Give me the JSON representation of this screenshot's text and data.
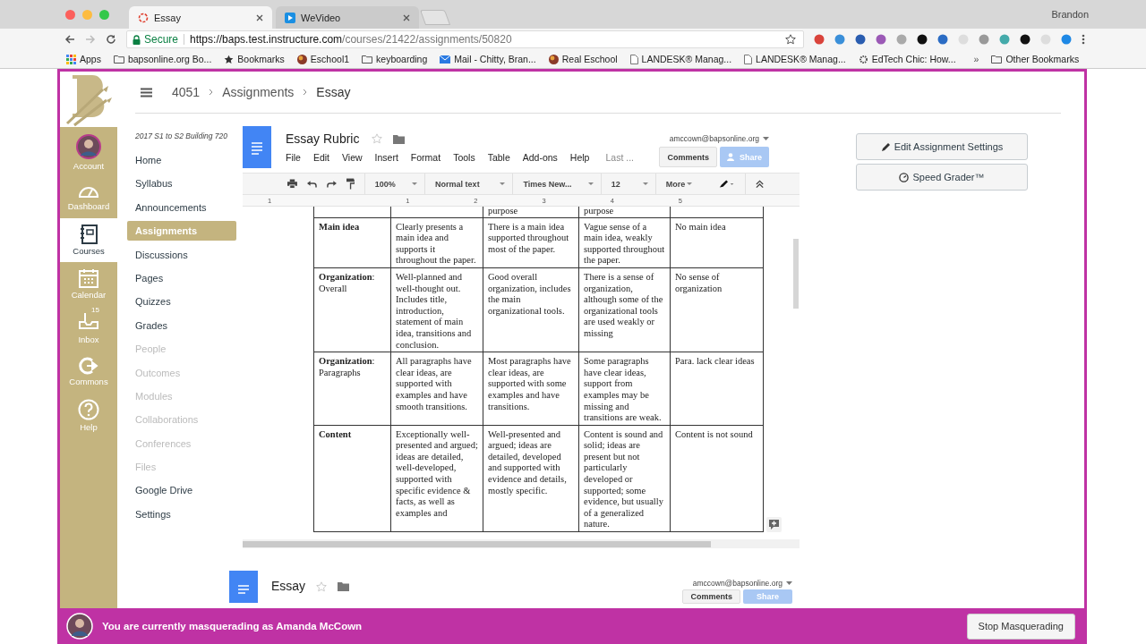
{
  "browser": {
    "tabs": [
      {
        "title": "Essay",
        "kind": "canvas",
        "selected": true
      },
      {
        "title": "WeVideo",
        "kind": "wevideo",
        "selected": false
      }
    ],
    "profile": "Brandon",
    "secure_label": "Secure",
    "url_host": "https://baps.test.instructure.com",
    "url_path": "/courses/21422/assignments/50820",
    "bookmarks": [
      {
        "kind": "apps",
        "label": "Apps"
      },
      {
        "kind": "folder",
        "label": "bapsonline.org Bo..."
      },
      {
        "kind": "star",
        "label": "Bookmarks"
      },
      {
        "kind": "globe",
        "label": "Eschool1"
      },
      {
        "kind": "folder",
        "label": "keyboarding"
      },
      {
        "kind": "mail",
        "label": "Mail - Chitty, Bran..."
      },
      {
        "kind": "globe",
        "label": "Real Eschool"
      },
      {
        "kind": "page",
        "label": "LANDESK® Manag..."
      },
      {
        "kind": "page",
        "label": "LANDESK® Manag..."
      },
      {
        "kind": "gear",
        "label": "EdTech Chic: How..."
      }
    ],
    "overflow": "»",
    "other_bookmarks": "Other Bookmarks"
  },
  "global_nav": [
    {
      "kind": "account",
      "label": "Account",
      "selected": false
    },
    {
      "kind": "dashboard",
      "label": "Dashboard",
      "selected": false
    },
    {
      "kind": "courses",
      "label": "Courses",
      "selected": true
    },
    {
      "kind": "calendar",
      "label": "Calendar",
      "selected": false
    },
    {
      "kind": "inbox",
      "label": "Inbox",
      "badge": "15",
      "selected": false
    },
    {
      "kind": "commons",
      "label": "Commons",
      "selected": false
    },
    {
      "kind": "help",
      "label": "Help",
      "selected": false
    }
  ],
  "breadcrumbs": [
    "4051",
    "Assignments",
    "Essay"
  ],
  "course_nav": {
    "term": "2017 S1 to S2 Building 720",
    "items": [
      {
        "label": "Home",
        "selected": false,
        "disabled": false
      },
      {
        "label": "Syllabus",
        "selected": false,
        "disabled": false
      },
      {
        "label": "Announcements",
        "selected": false,
        "disabled": false
      },
      {
        "label": "Assignments",
        "selected": true,
        "disabled": false
      },
      {
        "label": "Discussions",
        "selected": false,
        "disabled": false
      },
      {
        "label": "Pages",
        "selected": false,
        "disabled": false
      },
      {
        "label": "Quizzes",
        "selected": false,
        "disabled": false
      },
      {
        "label": "Grades",
        "selected": false,
        "disabled": false
      },
      {
        "label": "People",
        "selected": false,
        "disabled": true
      },
      {
        "label": "Outcomes",
        "selected": false,
        "disabled": true
      },
      {
        "label": "Modules",
        "selected": false,
        "disabled": true
      },
      {
        "label": "Collaborations",
        "selected": false,
        "disabled": true
      },
      {
        "label": "Conferences",
        "selected": false,
        "disabled": true
      },
      {
        "label": "Files",
        "selected": false,
        "disabled": true
      },
      {
        "label": "Google Drive",
        "selected": false,
        "disabled": false
      },
      {
        "label": "Settings",
        "selected": false,
        "disabled": false
      }
    ]
  },
  "document": {
    "title": "Essay Rubric",
    "account": "amccown@bapsonline.org",
    "menus": [
      "File",
      "Edit",
      "View",
      "Insert",
      "Format",
      "Tools",
      "Table",
      "Add-ons",
      "Help"
    ],
    "last_edit": "Last ...",
    "comments": "Comments",
    "share": "Share",
    "toolbar": {
      "zoom": "100%",
      "style": "Normal text",
      "font": "Times New...",
      "size": "12",
      "more": "More"
    },
    "ruler": [
      "1",
      "1",
      "2",
      "3",
      "4",
      "5"
    ],
    "rubric_rows": [
      [
        "",
        "",
        "purpose",
        "purpose",
        ""
      ],
      [
        "**Main idea**",
        "Clearly presents a main idea and supports it throughout the paper.",
        "There is a main idea supported throughout most of the paper.",
        "Vague sense of a main idea, weakly supported throughout the paper.",
        "No main idea"
      ],
      [
        "**Organization**: Overall",
        "Well-planned and well-thought out. Includes title, introduction, statement of main idea, transitions and conclusion.",
        "Good overall organization, includes the main organizational tools.",
        "There is a sense of organization, although some of the organizational tools are used weakly or missing",
        "No sense of organization"
      ],
      [
        "**Organization**: Paragraphs",
        "All paragraphs have clear ideas, are supported with examples and have smooth transitions.",
        "Most paragraphs have clear ideas, are supported with some examples and have transitions.",
        "Some paragraphs have clear ideas, support from examples may be missing and transitions are weak.",
        "Para. lack clear ideas"
      ],
      [
        "**Content**",
        "Exceptionally well-presented and argued; ideas are detailed, well-developed, supported with specific evidence & facts, as well as examples and",
        "Well-presented and argued; ideas are detailed, developed and supported with evidence and details, mostly specific.",
        "Content is sound and solid; ideas are present but not particularly developed or supported; some evidence, but usually of a generalized nature.",
        "Content is not sound"
      ]
    ]
  },
  "second_document": {
    "title": "Essay",
    "account": "amccown@bapsonline.org",
    "comments": "Comments",
    "share": "Share"
  },
  "sidebar_buttons": [
    {
      "kind": "edit",
      "label": "Edit Assignment Settings"
    },
    {
      "kind": "grader",
      "label": "Speed Grader™"
    }
  ],
  "masquerade": {
    "message": "You are currently masquerading as Amanda McCown",
    "button": "Stop Masquerading"
  }
}
